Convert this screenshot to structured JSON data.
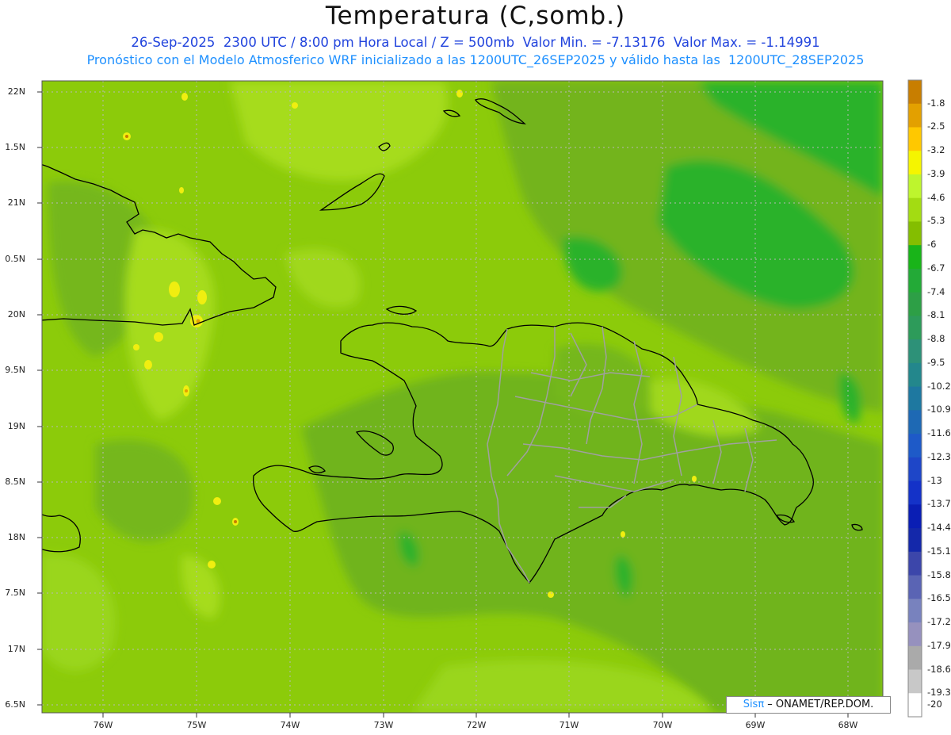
{
  "title": "Temperatura (C,somb.)",
  "subtitle1": "26-Sep-2025  2300 UTC / 8:00 pm Hora Local / Z = 500mb  Valor Min. = -7.13176  Valor Max. = -1.14991",
  "subtitle2": "Pronóstico con el Modelo Atmosferico WRF inicializado a las 1200UTC_26SEP2025 y válido hasta las  1200UTC_28SEP2025",
  "lat_labels": [
    "22N",
    "1.5N",
    "21N",
    "0.5N",
    "20N",
    "9.5N",
    "19N",
    "8.5N",
    "18N",
    "7.5N",
    "17N",
    "6.5N"
  ],
  "lon_labels": [
    "76W",
    "75W",
    "74W",
    "73W",
    "72W",
    "71W",
    "70W",
    "69W",
    "68W"
  ],
  "credit": {
    "brand": "Sisπ",
    "rest": " – ONAMET/REP.DOM."
  },
  "colorbar": {
    "labels": [
      "-1.8",
      "-2.5",
      "-3.2",
      "-3.9",
      "-4.6",
      "-5.3",
      "-6",
      "-6.7",
      "-7.4",
      "-8.1",
      "-8.8",
      "-9.5",
      "-10.2",
      "-10.9",
      "-11.6",
      "-12.3",
      "-13",
      "-13.7",
      "-14.4",
      "-15.1",
      "-15.8",
      "-16.5",
      "-17.2",
      "-17.9",
      "-18.6",
      "-19.3",
      "-20"
    ],
    "colors": [
      "#c87e00",
      "#e3a000",
      "#ffc800",
      "#f5f500",
      "#bef52d",
      "#a3dc12",
      "#84be00",
      "#19b419",
      "#23aa37",
      "#2d9f46",
      "#2d9b5a",
      "#2d9178",
      "#23878c",
      "#1e78a0",
      "#1e69b4",
      "#1e5ac8",
      "#1e46c8",
      "#1432c8",
      "#0a1eb4",
      "#1428aa",
      "#3c46aa",
      "#5a64b4",
      "#7882be",
      "#9691be",
      "#aaaaaa",
      "#c8c8c8",
      "#ffffff"
    ]
  },
  "palette": {
    "dark": "#6fb31f",
    "mid": "#86c806",
    "light": "#a9df1e",
    "yellow": "#f0ee10",
    "darkgreen": "#21b022",
    "coast": "#000000",
    "border": "#a0a0a0"
  }
}
